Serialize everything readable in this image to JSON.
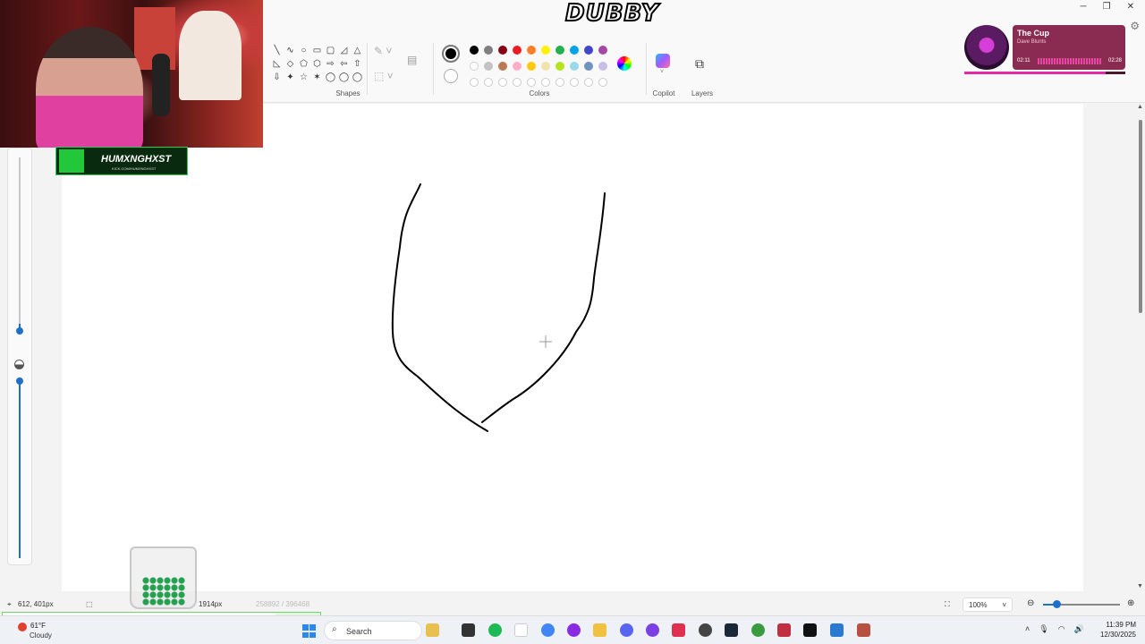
{
  "overlay": {
    "title_logo": "DUBBY",
    "music": {
      "title": "The Cup",
      "artist": "Dave Blunts",
      "elapsed": "02:11",
      "total": "02:28",
      "progress": 0.88
    },
    "streamer": {
      "name": "HUMXNGHXST",
      "url": "KICK.COM/HUMXNGHXST"
    }
  },
  "ribbon": {
    "groups": {
      "shapes": "Shapes",
      "colors": "Colors",
      "copilot": "Copilot",
      "layers": "Layers"
    },
    "shape_glyphs": [
      "╲",
      "∿",
      "○",
      "▭",
      "▢",
      "◿",
      "△",
      "◺",
      "◇",
      "⬠",
      "⬡",
      "⇨",
      "⇦",
      "⇧",
      "⇩",
      "✦",
      "☆",
      "✶",
      "◯",
      "◯",
      "◯"
    ],
    "primary_color": "#000000",
    "secondary_color": "#ffffff",
    "palette_row1": [
      "#000000",
      "#7f7f7f",
      "#880015",
      "#ed1c24",
      "#ff7f27",
      "#fff200",
      "#22b14c",
      "#00a2e8",
      "#3f48cc",
      "#a349a4"
    ],
    "palette_row2": [
      "",
      "#c3c3c3",
      "#b97a57",
      "#ffaec9",
      "#ffc90e",
      "#efe4b0",
      "#b5e61d",
      "#99d9ea",
      "#7092be",
      "#c8bfe7"
    ],
    "palette_row3": [
      "",
      "",
      "",
      "",
      "",
      "",
      "",
      "",
      "",
      ""
    ]
  },
  "window": {
    "minimize": "─",
    "maximize": "❐",
    "close": "✕"
  },
  "status": {
    "cursor_pos": "612, 401px",
    "selection": "",
    "canvas_size": "1914px",
    "file_size": "258892 / 396468",
    "zoom": "100%"
  },
  "taskbar": {
    "weather_temp": "61°F",
    "weather_cond": "Cloudy",
    "search_placeholder": "Search",
    "time": "11:39 PM",
    "date": "12/30/2025"
  },
  "accent": "#1e6fc8"
}
